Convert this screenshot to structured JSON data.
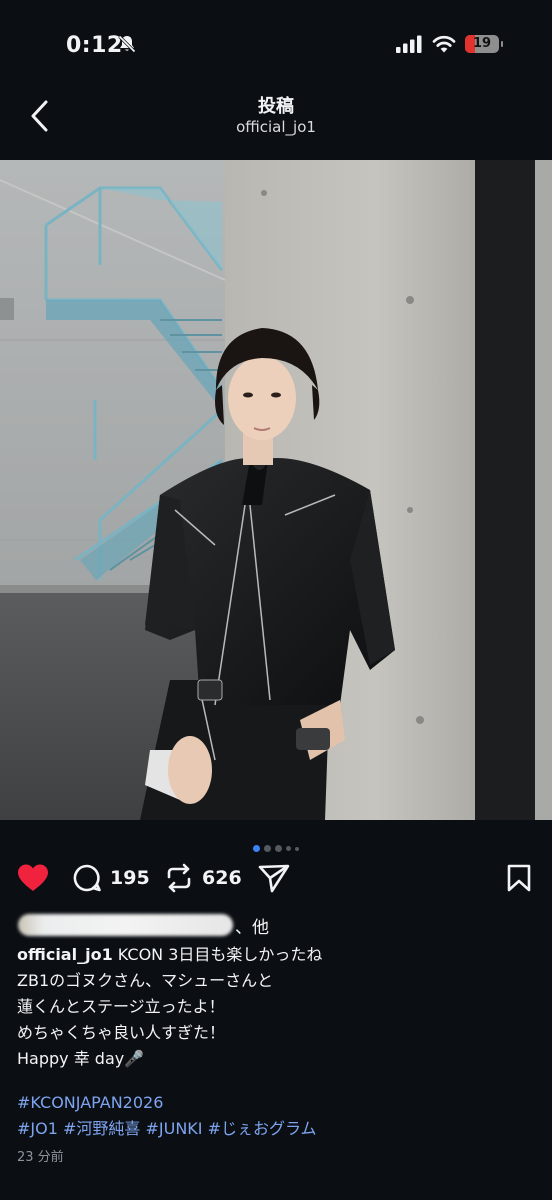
{
  "status_bar": {
    "time": "0:12",
    "battery": "19"
  },
  "header": {
    "title": "投稿",
    "subtitle": "official_jo1"
  },
  "carousel": {
    "count": 5,
    "active_index": 0
  },
  "actions": {
    "comments": "195",
    "reposts": "626",
    "liked": true
  },
  "likes": {
    "suffix": "、他"
  },
  "caption": {
    "username": "official_jo1",
    "line1": " KCON 3日目も楽しかったね",
    "line2": "ZB1のゴヌクさん、マシューさんと",
    "line3": "蓮くんとステージ立ったよ！",
    "line4": "めちゃくちゃ良い人すぎた！",
    "line5": "Happy 幸 day🎤"
  },
  "hashtags": {
    "line1": "#KCONJAPAN2026",
    "line2": "#JO1 #河野純喜 #JUNKI #じぇおグラム"
  },
  "timestamp": "23 分前",
  "colors": {
    "background": "#0b0f14",
    "like": "#f0223e",
    "link": "#7da4ee",
    "accent_dot": "#3b82f6"
  }
}
